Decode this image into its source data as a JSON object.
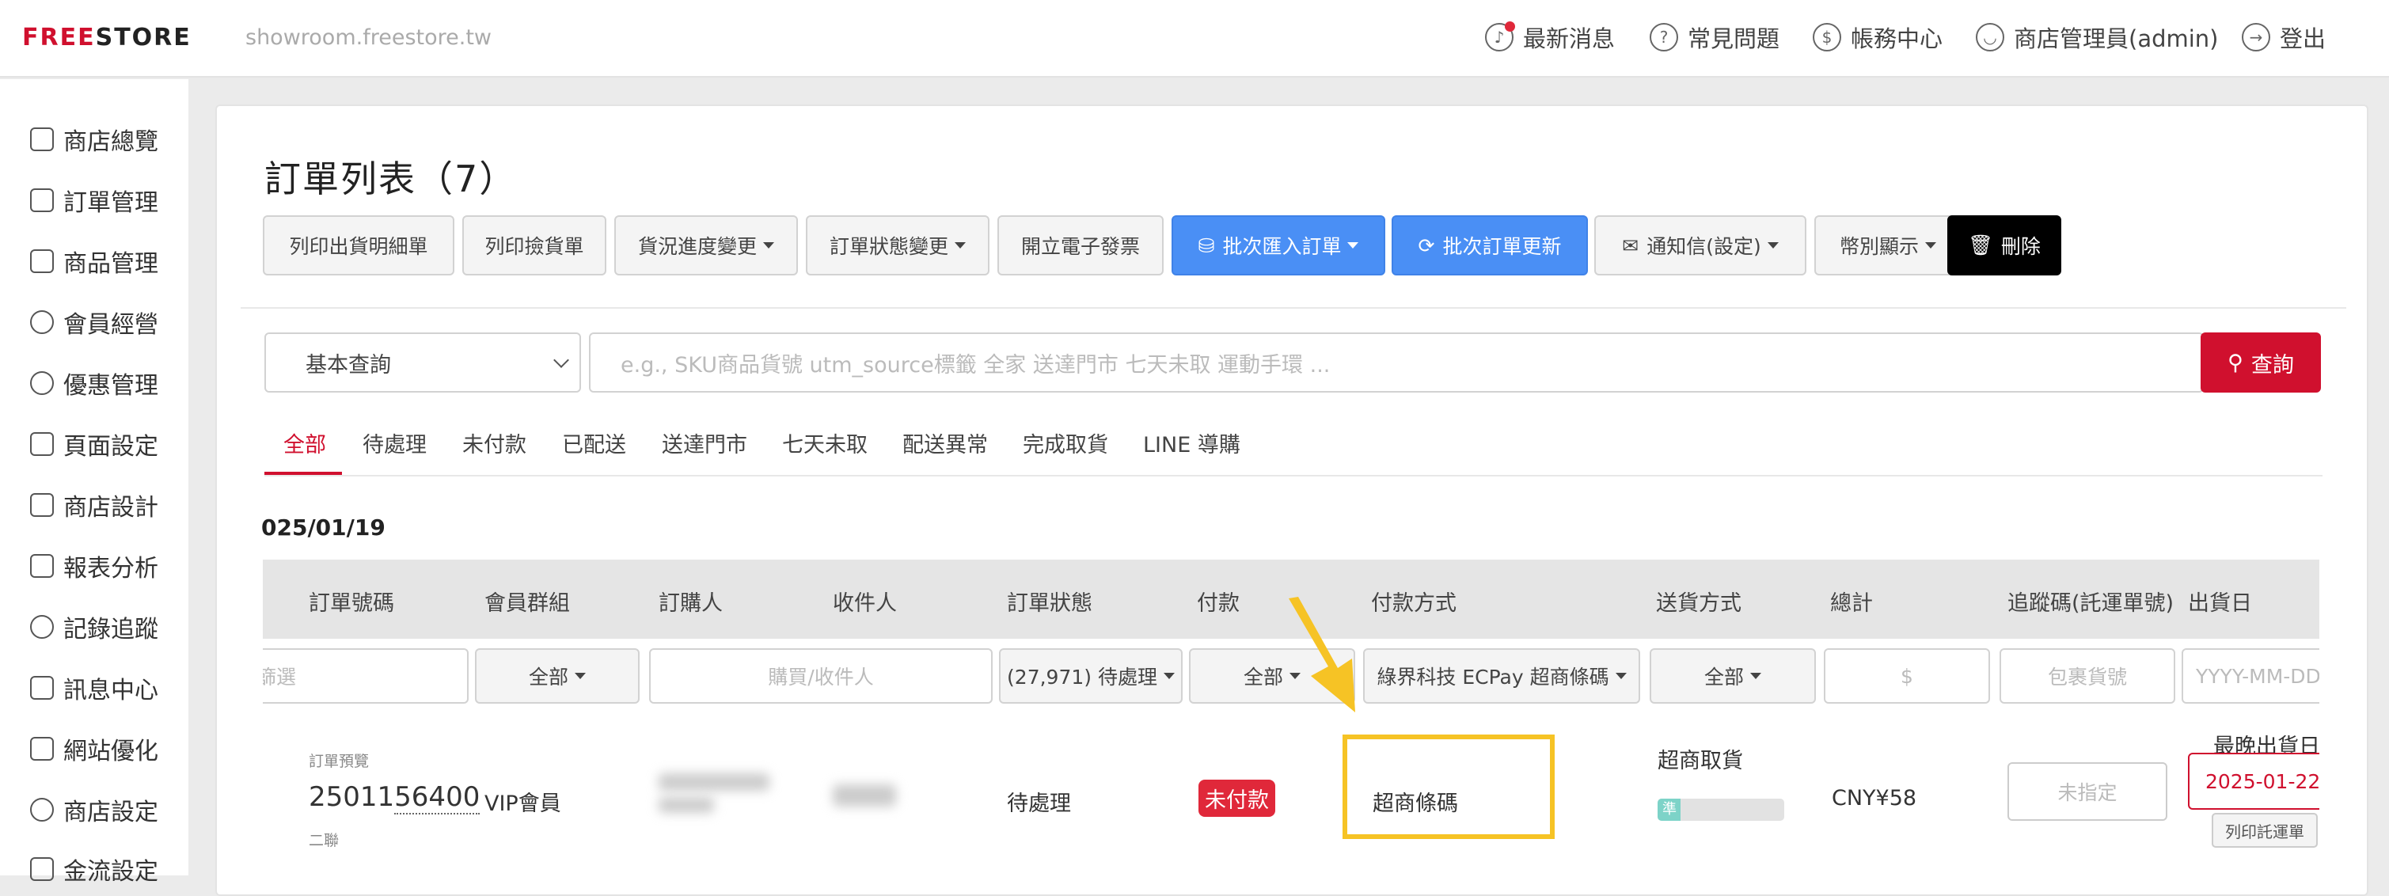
{
  "header": {
    "logo_a": "FREE",
    "logo_b": "STORE",
    "site_url": "showroom.freestore.tw",
    "nav": [
      {
        "label": "最新消息",
        "icon": "bell-icon"
      },
      {
        "label": "常見問題",
        "icon": "question-icon"
      },
      {
        "label": "帳務中心",
        "icon": "dollar-icon"
      },
      {
        "label": "商店管理員(admin)",
        "icon": "user-icon"
      },
      {
        "label": "登出",
        "icon": "logout-icon"
      }
    ]
  },
  "sidebar": {
    "items": [
      {
        "label": "商店總覽"
      },
      {
        "label": "訂單管理"
      },
      {
        "label": "商品管理"
      },
      {
        "label": "會員經營"
      },
      {
        "label": "優惠管理"
      },
      {
        "label": "頁面設定"
      },
      {
        "label": "商店設計"
      },
      {
        "label": "報表分析"
      },
      {
        "label": "記錄追蹤"
      },
      {
        "label": "訊息中心"
      },
      {
        "label": "網站優化"
      },
      {
        "label": "商店設定"
      },
      {
        "label": "金流設定"
      }
    ]
  },
  "main": {
    "title": "訂單列表（7）",
    "toolbar": [
      {
        "label": "列印出貨明細單"
      },
      {
        "label": "列印撿貨單"
      },
      {
        "label": "貨況進度變更"
      },
      {
        "label": "訂單狀態變更"
      },
      {
        "label": "開立電子發票"
      },
      {
        "label": "批次匯入訂單"
      },
      {
        "label": "批次訂單更新"
      },
      {
        "label": "通知信(設定)"
      },
      {
        "label": "幣別顯示"
      },
      {
        "label": "刪除"
      }
    ],
    "search": {
      "mode": "基本查詢",
      "placeholder": "e.g.,  SKU商品貨號   utm_source標籤   全家   送達門市   七天未取   運動手環  ...",
      "button": "查詢"
    },
    "tabs": [
      "全部",
      "待處理",
      "未付款",
      "已配送",
      "送達門市",
      "七天未取",
      "配送異常",
      "完成取貨",
      "LINE 導購"
    ],
    "date_group": "025/01/19",
    "table": {
      "headers": [
        "訂單號碼",
        "會員群組",
        "訂購人",
        "收件人",
        "訂單狀態",
        "付款",
        "付款方式",
        "送貨方式",
        "總計",
        "追蹤碼(託運單號)",
        "出貨日"
      ],
      "filters": {
        "order_no": "篩選",
        "member_group": "全部",
        "buyer": "購買/收件人",
        "status": "(27,971) 待處理",
        "payment": "全部",
        "payment_method": "綠界科技 ECPay 超商條碼",
        "shipping": "全部",
        "total": "$",
        "tracking": "包裹貨號",
        "ship_date": "YYYY-MM-DD"
      },
      "row": {
        "preview": "訂單預覽",
        "order_no_a": "25011",
        "order_no_b": "56400",
        "copy": "二聯",
        "member_group": "VIP會員",
        "status": "待處理",
        "payment": "未付款",
        "payment_method": "超商條碼",
        "shipping": "超商取貨",
        "progress_label": "準",
        "total": "CNY¥58",
        "tracking": "未指定",
        "latest_ship_label": "最晚出貨日",
        "ship_date": "2025-01-22",
        "print_waybill": "列印託運單"
      }
    }
  },
  "colors": {
    "accent": "#d0102e",
    "blue": "#4a8ff5",
    "highlight": "#f6c325"
  }
}
